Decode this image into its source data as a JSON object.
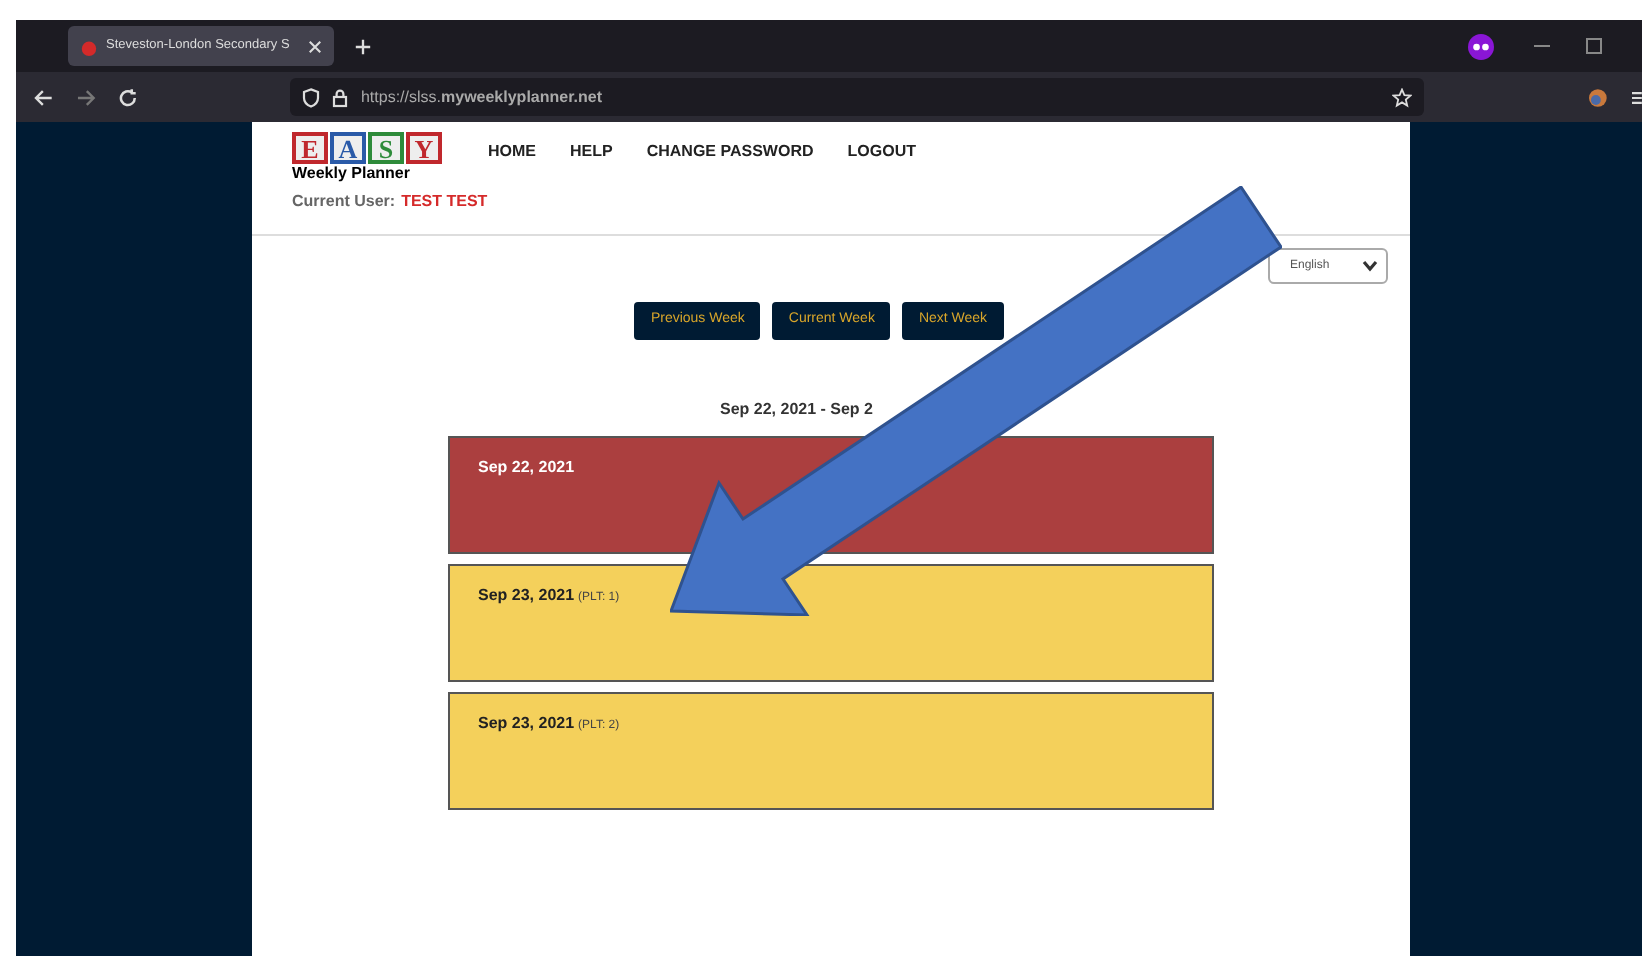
{
  "browser": {
    "tab_title": "Steveston-London Secondary S",
    "url": "https://slss.**myweeklyplanner.net**"
  },
  "logo": {
    "letters": [
      {
        "text": "E",
        "color": "#c0282d"
      },
      {
        "text": "A",
        "color": "#2a5aa8"
      },
      {
        "text": "S",
        "color": "#2e8b3a"
      },
      {
        "text": "Y",
        "color": "#c0282d"
      }
    ],
    "subtitle": "Weekly Planner"
  },
  "nav": [
    "HOME",
    "HELP",
    "CHANGE PASSWORD",
    "LOGOUT"
  ],
  "current_user": {
    "label": "Current User:",
    "value": "TEST TEST"
  },
  "language": {
    "value": "English"
  },
  "week_buttons": [
    "Previous Week",
    "Current Week",
    "Next Week"
  ],
  "date_range": "Sep 22, 2021 - Sep 2",
  "days": [
    {
      "date": "Sep 22, 2021",
      "color": "#ab3f3f"
    },
    {
      "date": "Sep 23, 2021",
      "note": "(PLT: 1)",
      "color": "#f4d05b"
    },
    {
      "date": "Sep 23, 2021",
      "note": "(PLT: 2)",
      "color": "#f4d05b"
    }
  ]
}
